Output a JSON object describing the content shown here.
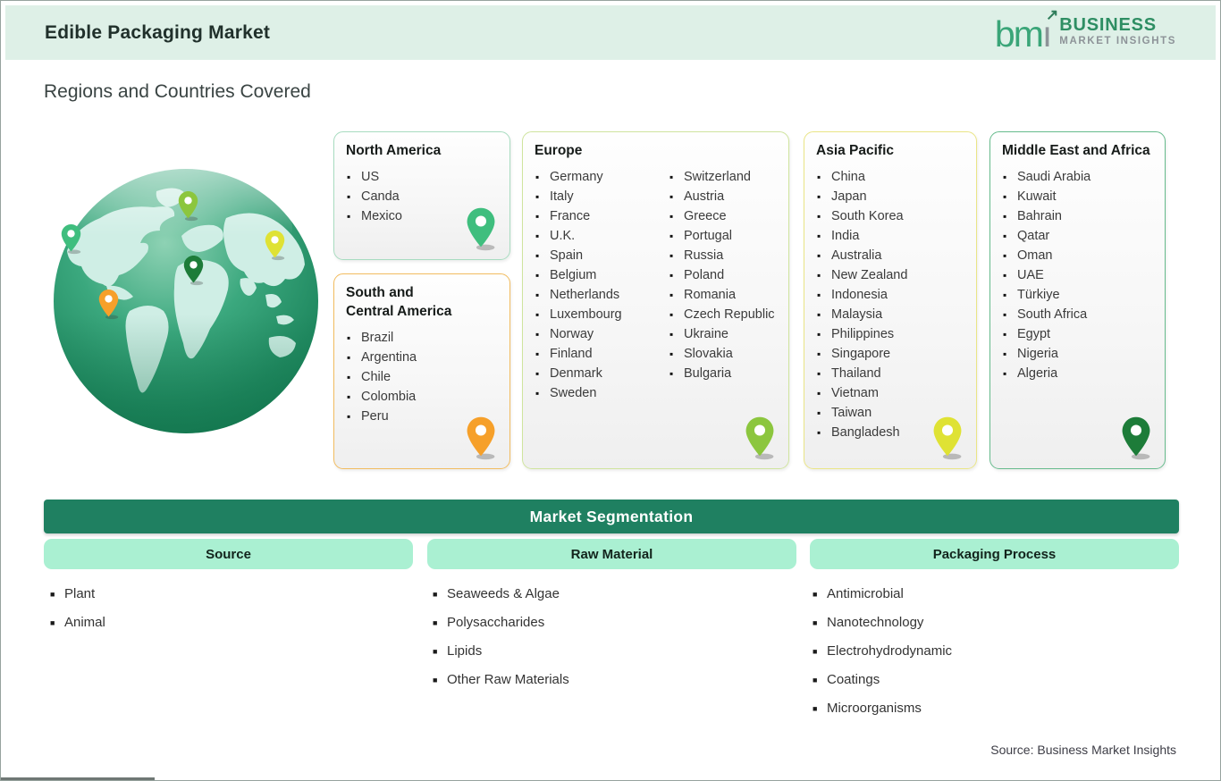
{
  "header": {
    "title": "Edible Packaging Market",
    "logo": {
      "mark_bm": "bm",
      "mark_i": "ı",
      "arrow": "↗",
      "line1": "BUSINESS",
      "line2": "MARKET INSIGHTS"
    }
  },
  "page": {
    "subtitle": "Regions and Countries Covered",
    "source_note": "Source: Business Market Insights"
  },
  "regions": [
    {
      "title": "North America",
      "countries": [
        "US",
        "Canda",
        "Mexico"
      ],
      "border_color": "#a8dcc0",
      "pin_color": "#3fbe7e"
    },
    {
      "title": "South and Central America",
      "countries": [
        "Brazil",
        "Argentina",
        "Chile",
        "Colombia",
        "Peru"
      ],
      "border_color": "#f2bc5f",
      "pin_color": "#f6a02a"
    },
    {
      "title": "Europe",
      "columns": [
        [
          "Germany",
          "Italy",
          "France",
          "U.K.",
          "Spain",
          "Belgium",
          "Netherlands",
          "Luxembourg",
          "Norway",
          "Finland",
          "Denmark",
          "Sweden"
        ],
        [
          "Switzerland",
          "Austria",
          "Greece",
          "Portugal",
          "Russia",
          "Poland",
          "Romania",
          "Czech Republic",
          "Ukraine",
          "Slovakia",
          "Bulgaria"
        ]
      ],
      "border_color": "#cfe49e",
      "pin_color": "#8cc63e"
    },
    {
      "title": "Asia Pacific",
      "countries": [
        "China",
        "Japan",
        "South Korea",
        "India",
        "Australia",
        "New Zealand",
        "Indonesia",
        "Malaysia",
        "Philippines",
        "Singapore",
        "Thailand",
        "Vietnam",
        "Taiwan",
        "Bangladesh"
      ],
      "border_color": "#eae586",
      "pin_color": "#dfe234"
    },
    {
      "title": "Middle East and Africa",
      "countries": [
        "Saudi Arabia",
        "Kuwait",
        "Bahrain",
        "Qatar",
        "Oman",
        "UAE",
        "Türkiye",
        "South Africa",
        "Egypt",
        "Nigeria",
        "Algeria"
      ],
      "border_color": "#66bb8c",
      "pin_color": "#1d7c39"
    }
  ],
  "segmentation": {
    "title": "Market Segmentation",
    "columns": [
      {
        "title": "Source",
        "items": [
          "Plant",
          "Animal"
        ]
      },
      {
        "title": "Raw Material",
        "items": [
          "Seaweeds & Algae",
          "Polysaccharides",
          "Lipids",
          "Other Raw Materials"
        ]
      },
      {
        "title": "Packaging Process",
        "items": [
          "Antimicrobial",
          "Nanotechnology",
          "Electrohydrodynamic",
          "Coatings",
          "Microorganisms"
        ]
      }
    ]
  },
  "colors": {
    "header_band": "#def0e7",
    "segmentation_bar": "#1f8061",
    "segmentation_subheader": "#aaf0d2",
    "logo_green": "#2e8e63",
    "logo_gray": "#8d9398"
  }
}
